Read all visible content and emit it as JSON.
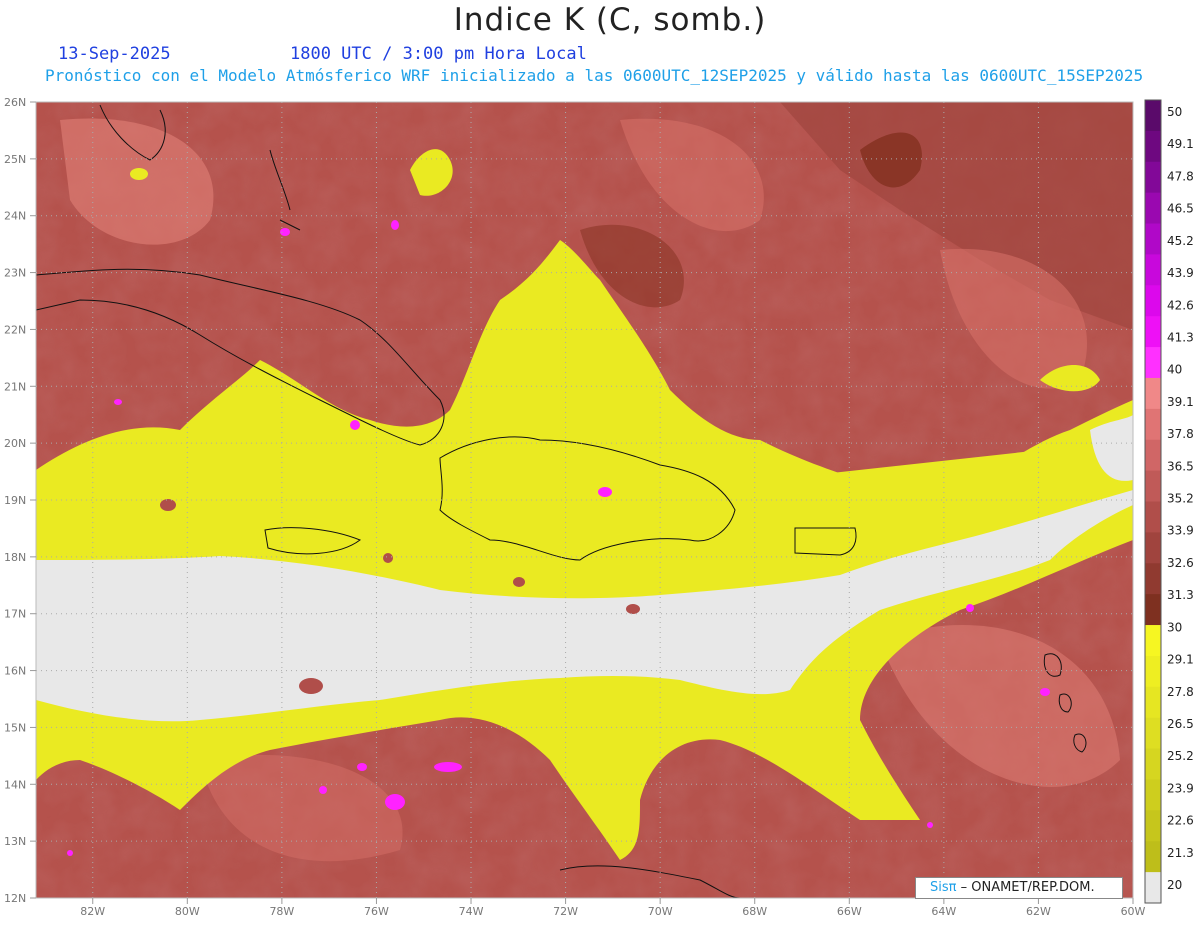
{
  "header": {
    "title": "Indice K (C, somb.)",
    "date": "13-Sep-2025",
    "time": "1800 UTC / 3:00 pm Hora Local",
    "subtitle": "Pronóstico con el Modelo Atmósferico WRF inicializado a las 0600UTC_12SEP2025 y válido hasta las  0600UTC_15SEP2025"
  },
  "map": {
    "lat_labels": [
      "26N",
      "25N",
      "24N",
      "23N",
      "22N",
      "21N",
      "20N",
      "19N",
      "18N",
      "17N",
      "16N",
      "15N",
      "14N",
      "13N",
      "12N"
    ],
    "lon_labels": [
      "82W",
      "80W",
      "78W",
      "76W",
      "74W",
      "72W",
      "70W",
      "68W",
      "66W",
      "64W",
      "62W",
      "60W"
    ],
    "lat_range": [
      12,
      26
    ],
    "lon_range": [
      -83.2,
      -60
    ],
    "grid": "dotted"
  },
  "colorbar": {
    "labels": [
      "50",
      "49.1",
      "47.8",
      "46.5",
      "45.2",
      "43.9",
      "42.6",
      "41.3",
      "40",
      "39.1",
      "37.8",
      "36.5",
      "35.2",
      "33.9",
      "32.6",
      "31.3",
      "30",
      "29.1",
      "27.8",
      "26.5",
      "25.2",
      "23.9",
      "22.6",
      "21.3",
      "20"
    ],
    "colors": {
      "band_40_50": [
        "#5a0a6a",
        "#6e0880",
        "#820898",
        "#9a08b0",
        "#b008c8",
        "#c808dc",
        "#dc08ec",
        "#ee10f6",
        "#ff30ff"
      ],
      "band_30_40": [
        "#f08888",
        "#e07474",
        "#d06666",
        "#c05a58",
        "#b04e4a",
        "#a0443e",
        "#903a30",
        "#7e3020"
      ],
      "band_20_30": [
        "#f6f622",
        "#eeee22",
        "#e6e622",
        "#dede22",
        "#d6d620",
        "#cece1e",
        "#c6c61c",
        "#bebe1a"
      ],
      "below_20": "#e8e8e8"
    }
  },
  "credit": {
    "logo": "Sisπ",
    "text": " – ONAMET/REP.DOM."
  }
}
